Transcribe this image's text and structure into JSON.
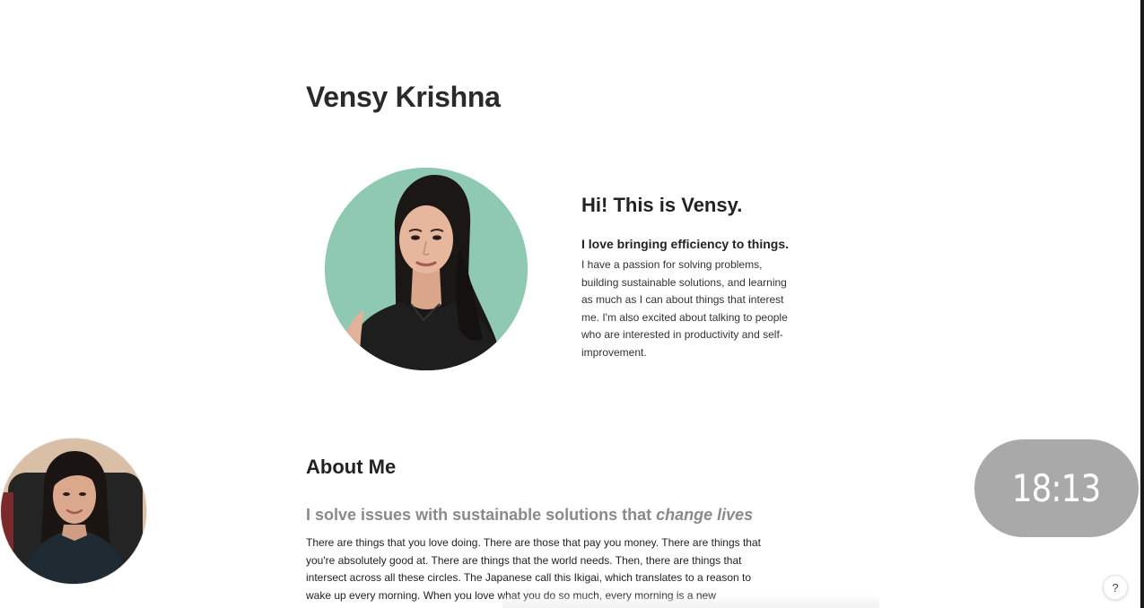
{
  "header": {
    "title": "Vensy Krishna"
  },
  "intro": {
    "heading": "Hi! This is Vensy.",
    "subheading": "I love bringing efficiency to things.",
    "body": "I have a passion for solving problems,\nbuilding sustainable solutions, and learning\nas much as I can about things that interest\nme. I'm also excited about talking to people\nwho are interested in productivity and self-\nimprovement."
  },
  "about": {
    "heading": "About Me",
    "tagline_plain": "I solve issues with sustainable solutions that ",
    "tagline_italic": "change lives",
    "body": "There are things that you love doing. There are those that pay you money. There are things that\nyou're absolutely good at. There are things that the world needs. Then, there are things that\nintersect across all these circles. The Japanese call this Ikigai, which translates to a reason to\nwake up every morning. When you love what you do so much, every morning is a new"
  },
  "overlay": {
    "clock_time": "18:13",
    "help_label": "?"
  },
  "colors": {
    "portrait_background": "#8fc9b2",
    "clock_background": "#a9a9a9",
    "tagline_gray": "#8a8a8a"
  },
  "icons": {
    "help": "question-mark-icon"
  }
}
